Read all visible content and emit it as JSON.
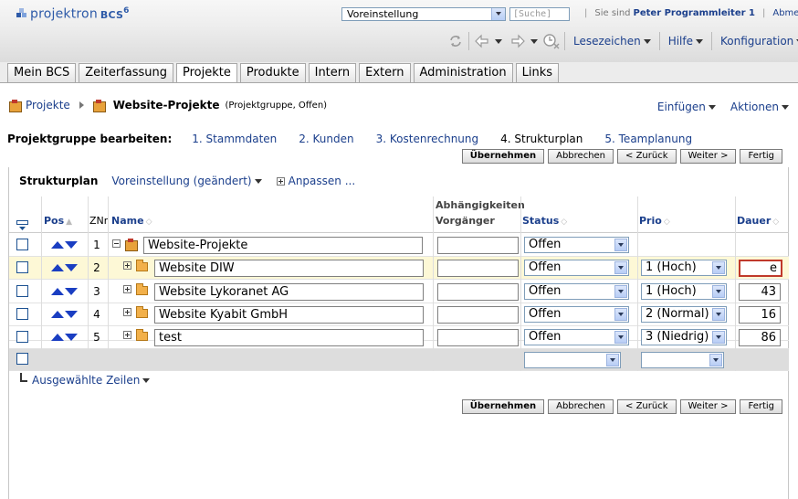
{
  "header": {
    "logo_text": "projektron",
    "logo_suffix": "BCS",
    "logo_version": "6",
    "preset_select": "Voreinstellung",
    "search_placeholder": "[Suche]",
    "you_are_label": "Sie sind",
    "user_name": "Peter Programmleiter 1",
    "logout_label": "Abmelden"
  },
  "toolbar": {
    "bookmarks_label": "Lesezeichen",
    "help_label": "Hilfe",
    "config_label": "Konfiguration"
  },
  "tabs": [
    {
      "label": "Mein BCS"
    },
    {
      "label": "Zeiterfassung"
    },
    {
      "label": "Projekte"
    },
    {
      "label": "Produkte"
    },
    {
      "label": "Intern"
    },
    {
      "label": "Extern"
    },
    {
      "label": "Administration"
    },
    {
      "label": "Links"
    }
  ],
  "active_tab": "Projekte",
  "breadcrumb": {
    "root": "Projekte",
    "current": "Website-Projekte",
    "subtitle": "(Projektgruppe, Offen)"
  },
  "page_actions": {
    "insert_label": "Einfügen",
    "actions_label": "Aktionen"
  },
  "steps": {
    "label": "Projektgruppe bearbeiten:",
    "items": [
      {
        "label": "1. Stammdaten"
      },
      {
        "label": "2. Kunden"
      },
      {
        "label": "3. Kostenrechnung"
      },
      {
        "label": "4. Strukturplan"
      },
      {
        "label": "5. Teamplanung"
      }
    ],
    "current": "4. Strukturplan"
  },
  "buttons": {
    "apply": "Übernehmen",
    "cancel": "Abbrechen",
    "back": "< Zurück",
    "next": "Weiter >",
    "finish": "Fertig"
  },
  "structure": {
    "title": "Strukturplan",
    "view_label": "Voreinstellung (geändert)",
    "adjust_label": "Anpassen ..."
  },
  "table": {
    "columns": {
      "pos": "Pos",
      "znr": "ZNr",
      "name": "Name",
      "dependencies_line1": "Abhängigkeiten",
      "dependencies_line2": "Vorgänger",
      "status": "Status",
      "prio": "Prio",
      "duration": "Dauer"
    },
    "rows": [
      {
        "znr": "1",
        "name": "Website-Projekte",
        "predecessor": "",
        "status": "Offen",
        "prio": "",
        "duration": ""
      },
      {
        "znr": "2",
        "name": "Website DIW",
        "predecessor": "",
        "status": "Offen",
        "prio": "1 (Hoch)",
        "duration": "e"
      },
      {
        "znr": "3",
        "name": "Website Lykoranet AG",
        "predecessor": "",
        "status": "Offen",
        "prio": "1 (Hoch)",
        "duration": "43"
      },
      {
        "znr": "4",
        "name": "Website Kyabit GmbH",
        "predecessor": "",
        "status": "Offen",
        "prio": "2 (Normal)",
        "duration": "16"
      },
      {
        "znr": "5",
        "name": "test",
        "predecessor": "",
        "status": "Offen",
        "prio": "3 (Niedrig)",
        "duration": "86"
      }
    ],
    "new_row": {
      "status": "",
      "prio": ""
    }
  },
  "selected_rows_label": "Ausgewählte Zeilen"
}
